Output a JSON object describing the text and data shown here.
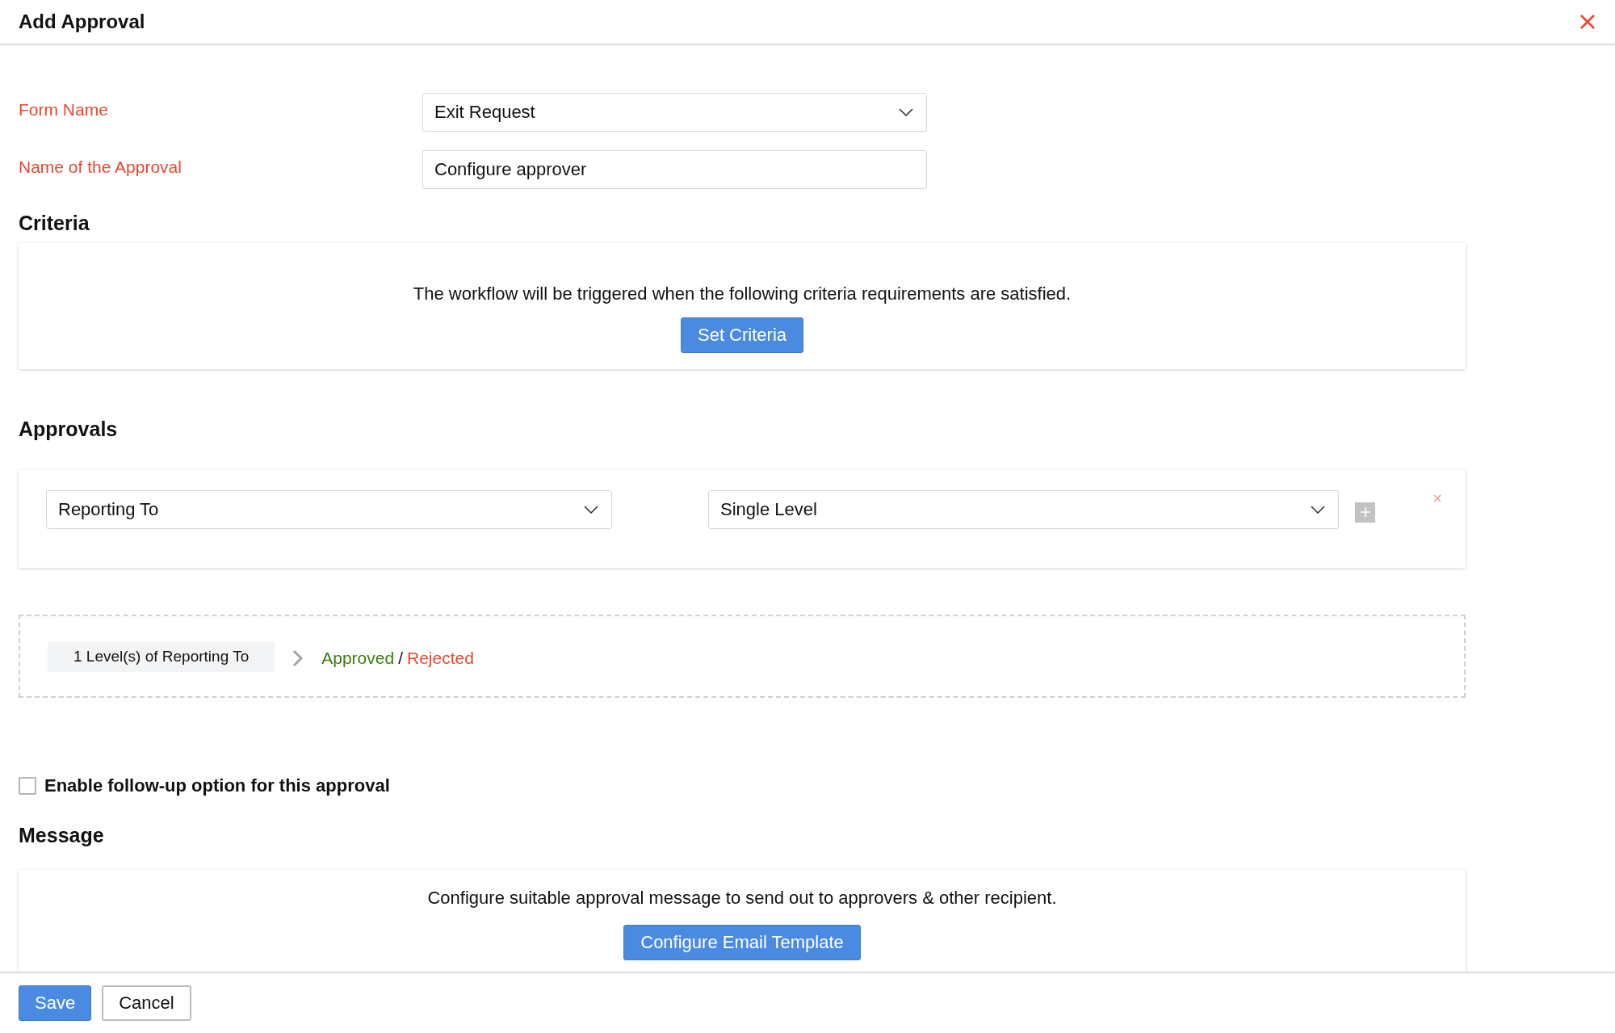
{
  "window": {
    "title": "Add Approval"
  },
  "fields": [
    {
      "label": "Form Name",
      "kind": "dropdown",
      "value": "Exit Request"
    },
    {
      "label": "Name of the Approval",
      "kind": "text",
      "value": "Configure approver"
    }
  ],
  "criteria": {
    "heading": "Criteria",
    "text": "The workflow will be triggered when the following criteria requirements are satisfied.",
    "button": "Set Criteria"
  },
  "approvals": {
    "heading": "Approvals",
    "approver": "Reporting To",
    "level_type": "Single Level",
    "flow": {
      "step": "1 Level(s) of Reporting To",
      "approved": "Approved",
      "separator": "/",
      "rejected": "Rejected"
    }
  },
  "follow_up": {
    "label": "Enable follow-up option for this approval",
    "checked": false
  },
  "message": {
    "heading": "Message",
    "text": "Configure suitable approval message to send out to approvers & other recipient.",
    "button": "Configure Email Template"
  },
  "footer": {
    "buttons": [
      {
        "label": "Save",
        "kind": "primary"
      },
      {
        "label": "Cancel",
        "kind": "secondary"
      }
    ]
  }
}
